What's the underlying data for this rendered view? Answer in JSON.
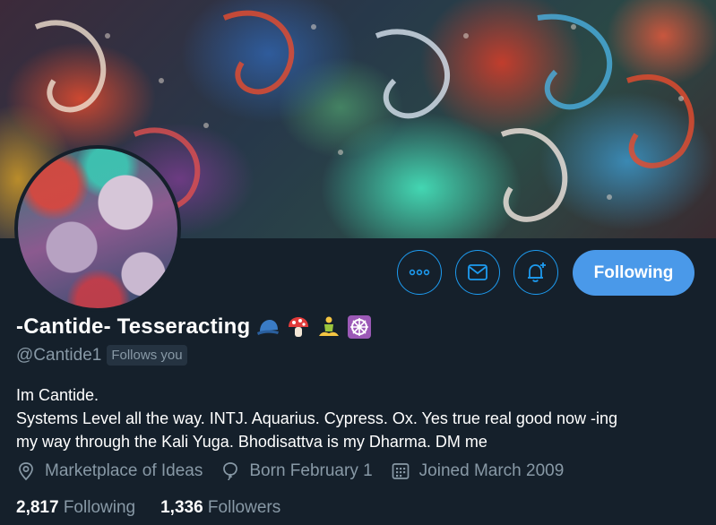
{
  "profile": {
    "display_name": "-Cantide- Tesseracting",
    "name_emojis": [
      "blue-cap-emoji",
      "mushroom-emoji",
      "meditating-person-emoji",
      "dharma-wheel-emoji"
    ],
    "handle": "@Cantide1",
    "follows_you_label": "Follows you",
    "bio_lines": [
      "Im Cantide.",
      "Systems Level all the way. INTJ. Aquarius. Cypress. Ox. Yes true real good now -ing",
      "my way through the Kali Yuga. Bhodisattva is my Dharma. DM me"
    ],
    "location": "Marketplace of Ideas",
    "birthday": "Born February 1",
    "joined": "Joined March 2009",
    "following_count": "2,817",
    "following_label": "Following",
    "followers_count": "1,336",
    "followers_label": "Followers"
  },
  "actions": {
    "more_icon": "more-horizontal-icon",
    "message_icon": "envelope-icon",
    "notify_icon": "bell-plus-icon",
    "follow_button_label": "Following"
  },
  "colors": {
    "background": "#15202b",
    "accent": "#1d9bf0",
    "button_fill": "#4a99e9",
    "secondary_text": "#8899a6"
  }
}
